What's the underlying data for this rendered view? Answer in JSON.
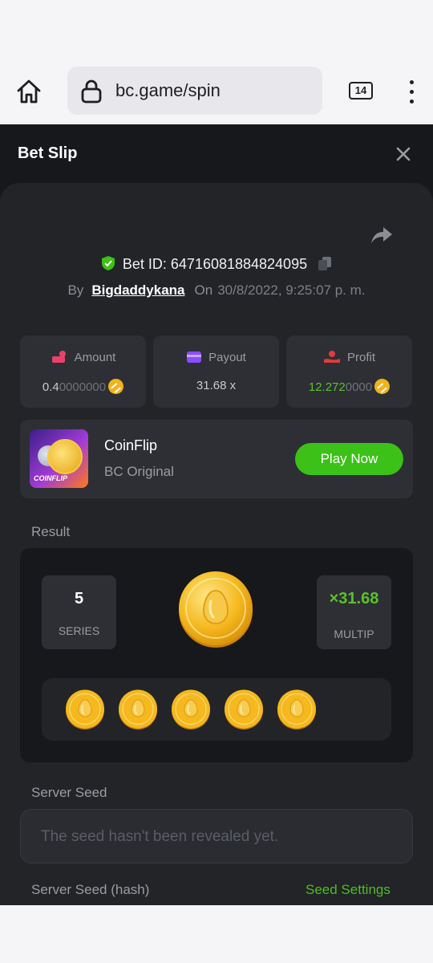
{
  "browser": {
    "url": "bc.game/spin",
    "tab_count": "14"
  },
  "slip": {
    "title": "Bet Slip",
    "bet_id_label": "Bet ID: 647160818848​24095",
    "by_label": "By",
    "username": "Bigdaddykana",
    "on_label": "On",
    "datetime": "30/8/2022, 9:25:07 p. m."
  },
  "stats": {
    "amount": {
      "label": "Amount",
      "value_main": "0.4",
      "value_dim": "0000000",
      "color": "#e9416a"
    },
    "payout": {
      "label": "Payout",
      "value": "31.68 x",
      "color": "#8a4dff"
    },
    "profit": {
      "label": "Profit",
      "value_main": "12.272",
      "value_dim": "0000",
      "color": "#e33b3b"
    }
  },
  "game": {
    "thumb_text": "COINFLIP",
    "name": "CoinFlip",
    "provider": "BC Original",
    "play_label": "Play Now"
  },
  "result": {
    "label": "Result",
    "series_value": "5",
    "series_label": "SERIES",
    "multiplier_value": "×31.68",
    "multiplier_label": "MULTIP",
    "coin_count": 5
  },
  "seed": {
    "server_seed_label": "Server Seed",
    "server_seed_placeholder": "The seed hasn't been revealed yet.",
    "hash_label": "Server Seed (hash)",
    "settings_link": "Seed Settings"
  },
  "colors": {
    "accent_green": "#3bc117",
    "coin_gold": "#f2b31a",
    "panel": "#222428",
    "background": "#17181b"
  }
}
